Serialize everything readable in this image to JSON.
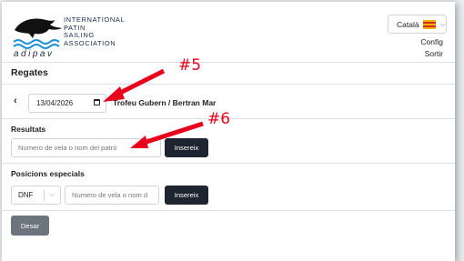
{
  "header": {
    "logo_lines": [
      "INTERNATIONAL",
      "PATIN",
      "SAILING",
      "ASSOCIATION"
    ],
    "logo_abbrev": "adipav",
    "language": {
      "selected": "Català",
      "flag_icon": "spanish-flag-icon"
    },
    "links": {
      "config": "Config",
      "logout": "Sortir"
    }
  },
  "page": {
    "title": "Regates",
    "date_value": "13/04/2026",
    "regatta_name": "Trofeu Gubern / Bertran Mar"
  },
  "results": {
    "label": "Resultats",
    "placeholder": "Numero de vela o nom del patró",
    "button": "Insereix"
  },
  "special": {
    "label": "Posicions especials",
    "select_value": "DNF",
    "placeholder": "Numero de vela o nom d",
    "button": "Insereix"
  },
  "save_button": "Desar",
  "annotations": {
    "first": "#5",
    "second": "#6",
    "color": "#e8001c"
  }
}
